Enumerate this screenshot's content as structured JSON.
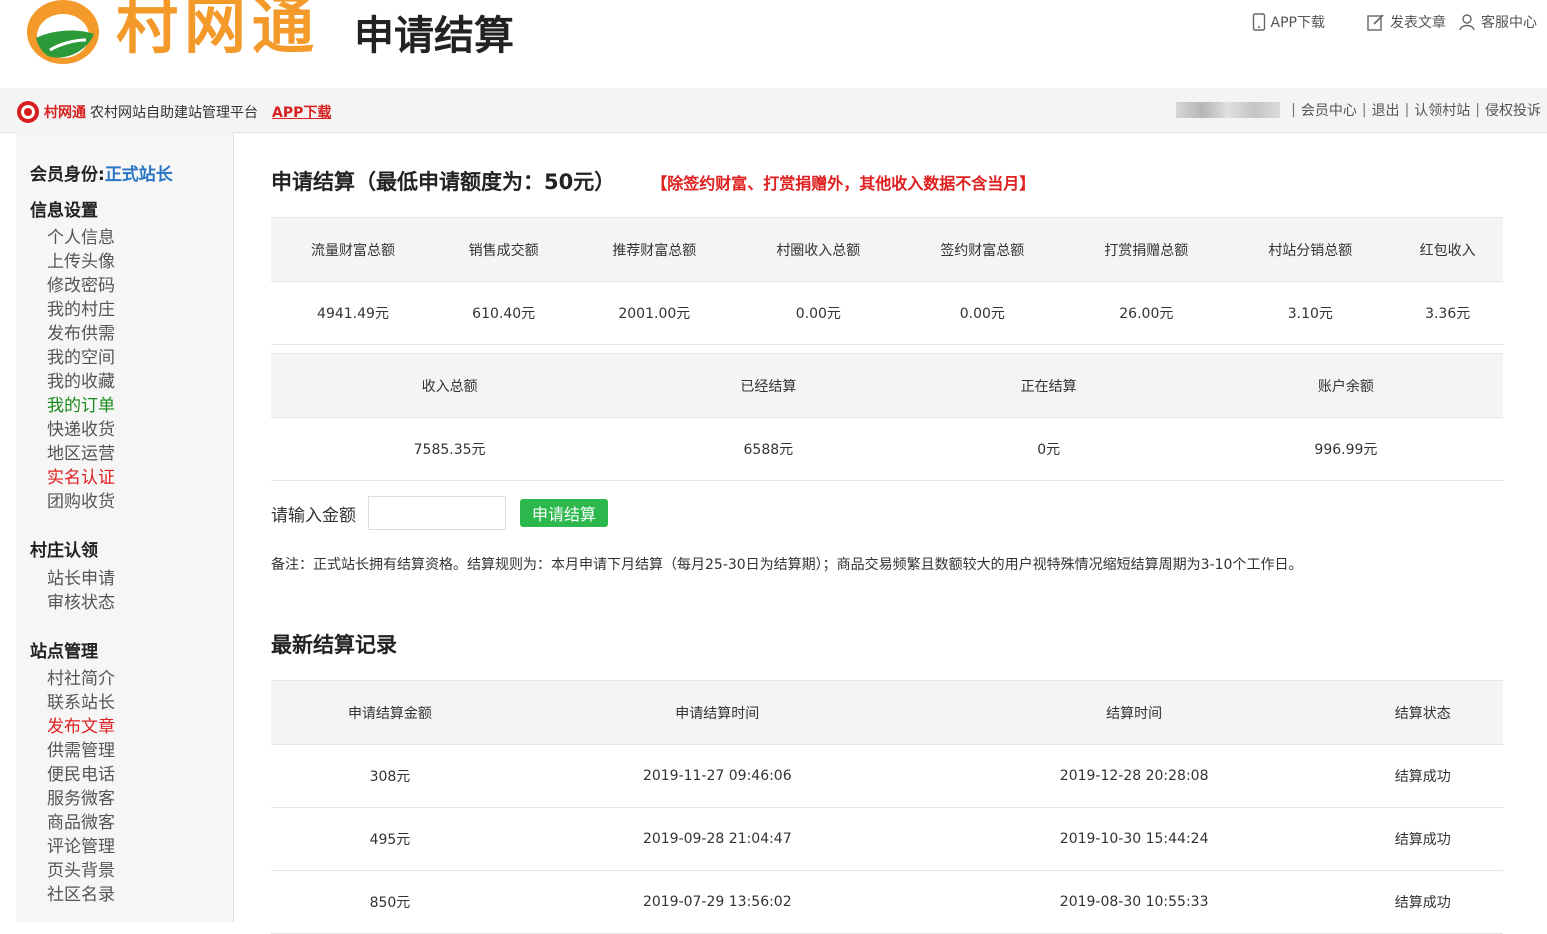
{
  "header": {
    "brand": "村网通",
    "page_heading": "申请结算",
    "app_download": "APP下载",
    "publish_article": "发表文章",
    "service_center": "客服中心",
    "logo_colors": {
      "orange": "#f39a2b",
      "green": "#2d9a3a"
    }
  },
  "subbar": {
    "brand": "村网通",
    "description": "农村网站自助建站管理平台",
    "app_link": "APP下载",
    "links": [
      "会员中心",
      "退出",
      "认领村站",
      "侵权投诉"
    ]
  },
  "sidebar": {
    "member_label": "会员身份:",
    "member_role": "正式站长",
    "sections": [
      {
        "title": "信息设置",
        "items": [
          {
            "label": "个人信息",
            "style": "normal"
          },
          {
            "label": "上传头像",
            "style": "normal"
          },
          {
            "label": "修改密码",
            "style": "normal"
          },
          {
            "label": "我的村庄",
            "style": "normal"
          },
          {
            "label": "发布供需",
            "style": "normal"
          },
          {
            "label": "我的空间",
            "style": "normal"
          },
          {
            "label": "我的收藏",
            "style": "normal"
          },
          {
            "label": "我的订单",
            "style": "green"
          },
          {
            "label": "快递收货",
            "style": "normal"
          },
          {
            "label": "地区运营",
            "style": "normal"
          },
          {
            "label": "实名认证",
            "style": "red"
          },
          {
            "label": "团购收货",
            "style": "normal"
          }
        ]
      },
      {
        "title": "村庄认领",
        "items": [
          {
            "label": "站长申请",
            "style": "normal"
          },
          {
            "label": "审核状态",
            "style": "normal"
          }
        ]
      },
      {
        "title": "站点管理",
        "items": [
          {
            "label": "村社简介",
            "style": "normal"
          },
          {
            "label": "联系站长",
            "style": "normal"
          },
          {
            "label": "发布文章",
            "style": "red"
          },
          {
            "label": "供需管理",
            "style": "normal"
          },
          {
            "label": "便民电话",
            "style": "normal"
          },
          {
            "label": "服务微客",
            "style": "normal"
          },
          {
            "label": "商品微客",
            "style": "normal"
          },
          {
            "label": "评论管理",
            "style": "normal"
          },
          {
            "label": "页头背景",
            "style": "normal"
          },
          {
            "label": "社区名录",
            "style": "normal"
          }
        ]
      }
    ]
  },
  "main": {
    "title": "申请结算（最低申请额度为：50元）",
    "notice": "【除签约财富、打赏捐赠外，其他收入数据不含当月】",
    "income_table": {
      "headers": [
        "流量财富总额",
        "销售成交额",
        "推荐财富总额",
        "村圈收入总额",
        "签约财富总额",
        "打赏捐赠总额",
        "村站分销总额",
        "红包收入"
      ],
      "values": [
        "4941.49元",
        "610.40元",
        "2001.00元",
        "0.00元",
        "0.00元",
        "26.00元",
        "3.10元",
        "3.36元"
      ]
    },
    "summary_table": {
      "headers": [
        "收入总额",
        "已经结算",
        "正在结算",
        "账户余额"
      ],
      "values": [
        "7585.35元",
        "6588元",
        "0元",
        "996.99元"
      ]
    },
    "input_label": "请输入金额",
    "apply_button": "申请结算",
    "remark": "备注：正式站长拥有结算资格。结算规则为：本月申请下月结算（每月25-30日为结算期）；商品交易频繁且数额较大的用户视特殊情况缩短结算周期为3-10个工作日。",
    "records_title": "最新结算记录",
    "records_table": {
      "headers": [
        "申请结算金额",
        "申请结算时间",
        "结算时间",
        "结算状态"
      ],
      "rows": [
        [
          "308元",
          "2019-11-27 09:46:06",
          "2019-12-28 20:28:08",
          "结算成功"
        ],
        [
          "495元",
          "2019-09-28 21:04:47",
          "2019-10-30 15:44:24",
          "结算成功"
        ],
        [
          "850元",
          "2019-07-29 13:56:02",
          "2019-08-30 10:55:33",
          "结算成功"
        ]
      ]
    }
  }
}
